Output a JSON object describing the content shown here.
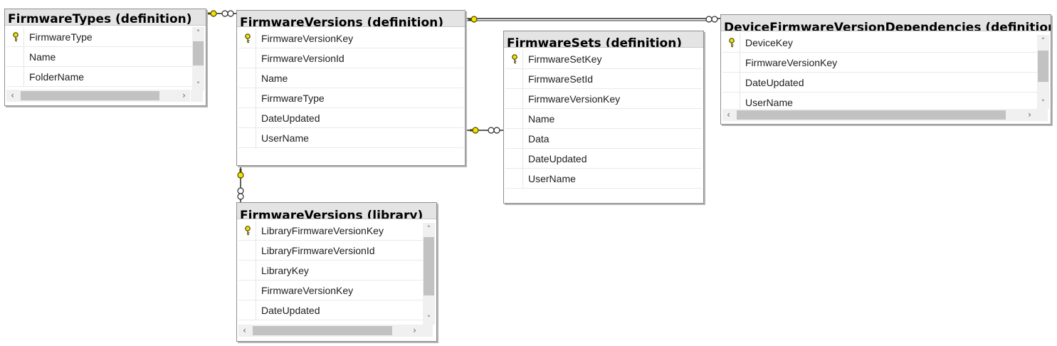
{
  "tables": {
    "firmware_types": {
      "title": "FirmwareTypes (definition)",
      "columns": [
        "FirmwareType",
        "Name",
        "FolderName"
      ],
      "key_columns": [
        "FirmwareType"
      ]
    },
    "firmware_versions_def": {
      "title": "FirmwareVersions (definition)",
      "columns": [
        "FirmwareVersionKey",
        "FirmwareVersionId",
        "Name",
        "FirmwareType",
        "DateUpdated",
        "UserName"
      ],
      "key_columns": [
        "FirmwareVersionKey"
      ]
    },
    "firmware_sets": {
      "title": "FirmwareSets (definition)",
      "columns": [
        "FirmwareSetKey",
        "FirmwareSetId",
        "FirmwareVersionKey",
        "Name",
        "Data",
        "DateUpdated",
        "UserName"
      ],
      "key_columns": [
        "FirmwareSetKey"
      ]
    },
    "device_fw_deps": {
      "title": "DeviceFirmwareVersionDependencies (definition)",
      "columns": [
        "DeviceKey",
        "FirmwareVersionKey",
        "DateUpdated",
        "UserName"
      ],
      "key_columns": [
        "DeviceKey"
      ]
    },
    "firmware_versions_lib": {
      "title": "FirmwareVersions (library)",
      "columns": [
        "LibraryFirmwareVersionKey",
        "LibraryFirmwareVersionId",
        "LibraryKey",
        "FirmwareVersionKey",
        "DateUpdated"
      ],
      "key_columns": [
        "LibraryFirmwareVersionKey"
      ]
    }
  },
  "icons": {
    "primary_key": "key-icon",
    "relationship_one_end": "key-icon",
    "relationship_many_end": "infinity-icon",
    "scroll_up": "chevron-up-icon",
    "scroll_down": "chevron-down-icon",
    "scroll_left": "chevron-left-icon",
    "scroll_right": "chevron-right-icon"
  },
  "colors": {
    "key_fill": "#f2e200",
    "key_stroke": "#4a4300",
    "relationship_line": "#2b2b2b",
    "title_bar": "#e4e4e4",
    "table_border": "#8f8f8f"
  }
}
